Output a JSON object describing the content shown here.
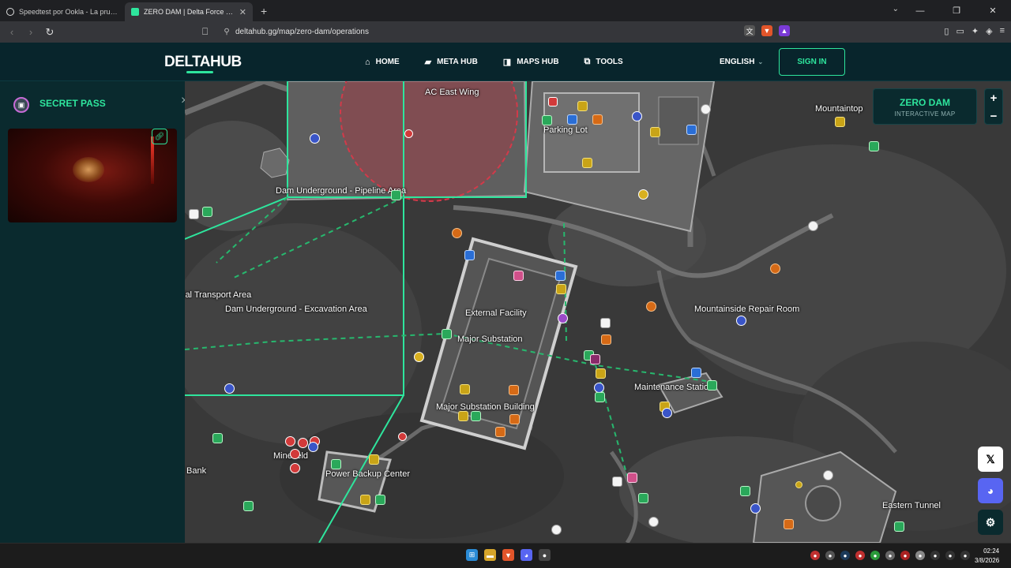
{
  "browser": {
    "tabs": [
      {
        "title": "Speedtest por Ookla - La prueba de",
        "active": false,
        "favicon": "speedtest-icon"
      },
      {
        "title": "ZERO DAM | Delta Force Interact",
        "active": true,
        "favicon": "deltahub-icon"
      }
    ],
    "new_tab_label": "+",
    "url": "deltahub.gg/map/zero-dam/operations"
  },
  "site": {
    "logo": "DELTAHUB",
    "nav": [
      {
        "label": "HOME",
        "icon": "home-icon"
      },
      {
        "label": "META HUB",
        "icon": "gun-icon"
      },
      {
        "label": "MAPS HUB",
        "icon": "map-icon"
      },
      {
        "label": "TOOLS",
        "icon": "tools-icon"
      }
    ],
    "language": "ENGLISH",
    "sign_in": "SIGN IN"
  },
  "panel": {
    "title": "SECRET PASS",
    "close": "×",
    "link_icon": "link-icon"
  },
  "map": {
    "badge_title": "ZERO DAM",
    "badge_subtitle": "INTERACTIVE MAP",
    "zoom_in": "+",
    "zoom_out": "−",
    "labels": [
      "AC East Wing",
      "Parking Lot",
      "Dam Underground - Pipeline Area",
      "ial Transport Area",
      "Dam Underground - Excavation Area",
      "External Facility",
      "Major Substation",
      "Major Substation Building",
      "Mountainside Repair Room",
      "Maintenance Station",
      "Power Backup Center",
      "Bank",
      "Minefield",
      "Mountaintop",
      "Eastern Tunnel"
    ],
    "zone_color": "#2ee59d",
    "danger_color": "#d23a4a"
  },
  "social": [
    "X",
    "Discord",
    "Settings"
  ],
  "taskbar": {
    "time": "02:24",
    "date": "3/8/2026"
  }
}
